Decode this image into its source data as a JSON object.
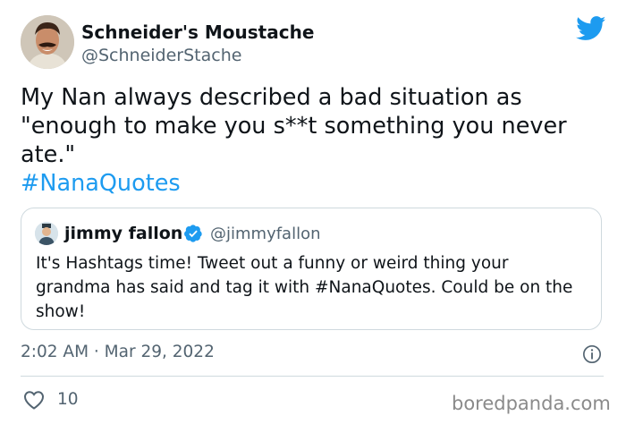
{
  "tweet": {
    "author": {
      "name": "Schneider's Moustache",
      "handle": "@SchneiderStache"
    },
    "text_lines": [
      "My Nan always described a bad situation as",
      "\"enough to make you s**t something you never",
      "ate.\""
    ],
    "hashtag": "#NanaQuotes",
    "timestamp": "2:02 AM · Mar 29, 2022",
    "likes": "10"
  },
  "quoted_tweet": {
    "author": {
      "name": "jimmy fallon",
      "handle": "@jimmyfallon",
      "verified": true
    },
    "text_lines": [
      "It's Hashtags time! Tweet out a funny or weird thing your",
      "grandma has said and tag it with #NanaQuotes. Could be on the",
      "show!"
    ]
  },
  "watermark": "boredpanda.com",
  "colors": {
    "accent": "#1d9bf0",
    "text": "#0f1419",
    "muted": "#536471",
    "border": "#cfd9de"
  },
  "icons": [
    "twitter-bird-icon",
    "verified-badge-icon",
    "info-icon",
    "heart-icon"
  ]
}
